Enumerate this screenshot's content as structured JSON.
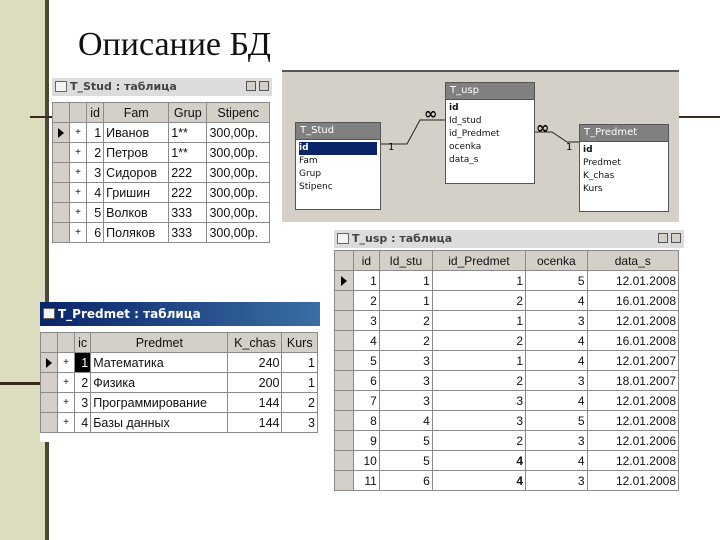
{
  "slide": {
    "title": "Описание БД"
  },
  "t_stud": {
    "title": "T_Stud : таблица",
    "columns": [
      "id",
      "Fam",
      "Grup",
      "Stipenc"
    ],
    "rows": [
      {
        "id": "1",
        "fam": "Иванов",
        "grup": "1**",
        "stip": "300,00р."
      },
      {
        "id": "2",
        "fam": "Петров",
        "grup": "1**",
        "stip": "300,00р."
      },
      {
        "id": "3",
        "fam": "Сидоров",
        "grup": "222",
        "stip": "300,00р."
      },
      {
        "id": "4",
        "fam": "Гришин",
        "grup": "222",
        "stip": "300,00р."
      },
      {
        "id": "5",
        "fam": "Волков",
        "grup": "333",
        "stip": "300,00р."
      },
      {
        "id": "6",
        "fam": "Поляков",
        "grup": "333",
        "stip": "300,00р."
      }
    ]
  },
  "diagram": {
    "t_stud": {
      "title": "T_Stud",
      "fields": [
        "id",
        "Fam",
        "Grup",
        "Stipenc"
      ]
    },
    "t_usp": {
      "title": "T_usp",
      "fields": [
        "id",
        "Id_stud",
        "id_Predmet",
        "ocenka",
        "data_s"
      ]
    },
    "t_predmet": {
      "title": "T_Predmet",
      "fields": [
        "id",
        "Predmet",
        "K_chas",
        "Kurs"
      ]
    },
    "cardinality": {
      "one": "1",
      "many": "∞"
    }
  },
  "t_usp": {
    "title": "T_usp : таблица",
    "columns": [
      "id",
      "Id_stu",
      "id_Predmet",
      "ocenka",
      "data_s"
    ],
    "rows": [
      {
        "id": "1",
        "id_stud": "1",
        "id_predmet": "1",
        "ocenka": "5",
        "data_s": "12.01.2008"
      },
      {
        "id": "2",
        "id_stud": "1",
        "id_predmet": "2",
        "ocenka": "4",
        "data_s": "16.01.2008"
      },
      {
        "id": "3",
        "id_stud": "2",
        "id_predmet": "1",
        "ocenka": "3",
        "data_s": "12.01.2008"
      },
      {
        "id": "4",
        "id_stud": "2",
        "id_predmet": "2",
        "ocenka": "4",
        "data_s": "16.01.2008"
      },
      {
        "id": "5",
        "id_stud": "3",
        "id_predmet": "1",
        "ocenka": "4",
        "data_s": "12.01.2007"
      },
      {
        "id": "6",
        "id_stud": "3",
        "id_predmet": "2",
        "ocenka": "3",
        "data_s": "18.01.2007"
      },
      {
        "id": "7",
        "id_stud": "3",
        "id_predmet": "3",
        "ocenka": "4",
        "data_s": "12.01.2008"
      },
      {
        "id": "8",
        "id_stud": "4",
        "id_predmet": "3",
        "ocenka": "5",
        "data_s": "12.01.2008"
      },
      {
        "id": "9",
        "id_stud": "5",
        "id_predmet": "2",
        "ocenka": "3",
        "data_s": "12.01.2006"
      },
      {
        "id": "10",
        "id_stud": "5",
        "id_predmet": "4",
        "ocenka": "4",
        "data_s": "12.01.2008"
      },
      {
        "id": "11",
        "id_stud": "6",
        "id_predmet": "4",
        "ocenka": "3",
        "data_s": "12.01.2008"
      }
    ]
  },
  "t_predmet": {
    "title": "T_Predmet : таблица",
    "columns": [
      "ic",
      "Predmet",
      "K_chas",
      "Kurs"
    ],
    "rows": [
      {
        "id": "1",
        "predmet": "Математика",
        "k_chas": "240",
        "kurs": "1"
      },
      {
        "id": "2",
        "predmet": "Физика",
        "k_chas": "200",
        "kurs": "1"
      },
      {
        "id": "3",
        "predmet": "Программирование",
        "k_chas": "144",
        "kurs": "2"
      },
      {
        "id": "4",
        "predmet": "Базы данных",
        "k_chas": "144",
        "kurs": "3"
      }
    ]
  },
  "colors": {
    "accent": "#0a246a",
    "grid_header": "#d4d0c8",
    "slide_bar": "#dcdcbe"
  }
}
